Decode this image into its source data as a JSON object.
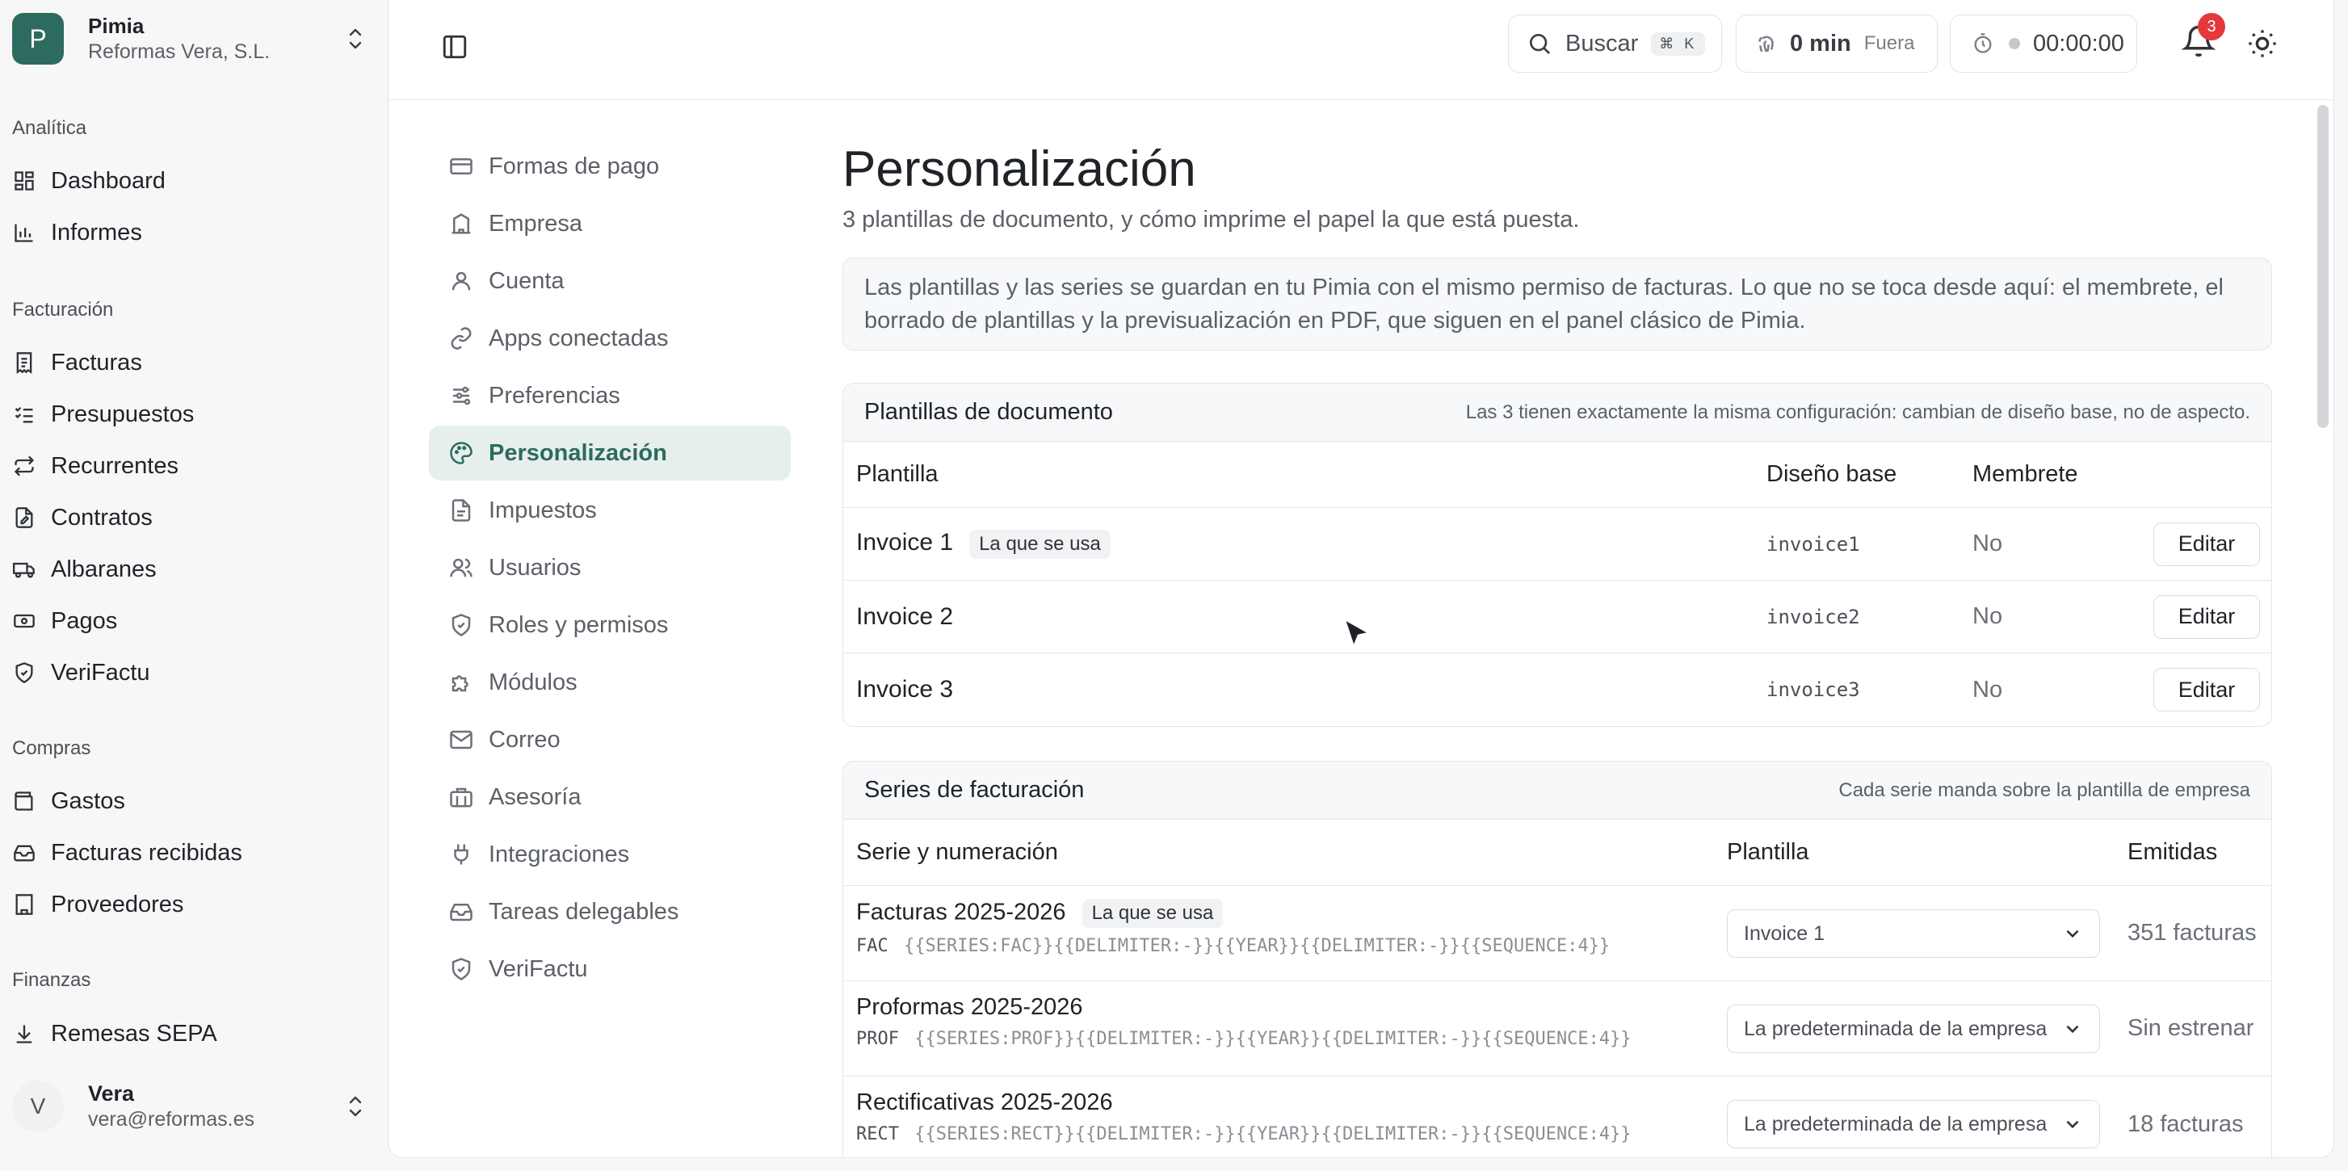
{
  "org": {
    "initial": "P",
    "name": "Pimia",
    "company": "Reformas Vera, S.L."
  },
  "nav": {
    "groups": [
      {
        "label": "Analítica",
        "items": [
          {
            "label": "Dashboard",
            "icon": "dashboard-icon"
          },
          {
            "label": "Informes",
            "icon": "bar-chart-icon"
          }
        ]
      },
      {
        "label": "Facturación",
        "items": [
          {
            "label": "Facturas",
            "icon": "invoice-icon"
          },
          {
            "label": "Presupuestos",
            "icon": "list-check-icon"
          },
          {
            "label": "Recurrentes",
            "icon": "repeat-icon"
          },
          {
            "label": "Contratos",
            "icon": "contract-icon"
          },
          {
            "label": "Albaranes",
            "icon": "truck-icon"
          },
          {
            "label": "Pagos",
            "icon": "banknote-icon"
          },
          {
            "label": "VeriFactu",
            "icon": "shield-check-icon"
          }
        ]
      },
      {
        "label": "Compras",
        "items": [
          {
            "label": "Gastos",
            "icon": "wallet-icon"
          },
          {
            "label": "Facturas recibidas",
            "icon": "inbox-icon"
          },
          {
            "label": "Proveedores",
            "icon": "building-icon"
          }
        ]
      },
      {
        "label": "Finanzas",
        "items": [
          {
            "label": "Remesas SEPA",
            "icon": "download-icon"
          }
        ]
      }
    ]
  },
  "user": {
    "initial": "V",
    "name": "Vera",
    "email": "vera@reformas.es"
  },
  "topbar": {
    "search_label": "Buscar",
    "search_shortcut": "⌘ K",
    "time_value": "0 min",
    "time_status": "Fuera",
    "timer_value": "00:00:00",
    "notifications_count": "3"
  },
  "settings_nav": [
    {
      "label": "Formas de pago",
      "icon": "credit-card-icon",
      "active": false
    },
    {
      "label": "Empresa",
      "icon": "building-icon",
      "active": false
    },
    {
      "label": "Cuenta",
      "icon": "user-icon",
      "active": false
    },
    {
      "label": "Apps conectadas",
      "icon": "link-icon",
      "active": false
    },
    {
      "label": "Preferencias",
      "icon": "sliders-icon",
      "active": false
    },
    {
      "label": "Personalización",
      "icon": "palette-icon",
      "active": true
    },
    {
      "label": "Impuestos",
      "icon": "document-icon",
      "active": false
    },
    {
      "label": "Usuarios",
      "icon": "users-icon",
      "active": false
    },
    {
      "label": "Roles y permisos",
      "icon": "shield-icon",
      "active": false
    },
    {
      "label": "Módulos",
      "icon": "puzzle-icon",
      "active": false
    },
    {
      "label": "Correo",
      "icon": "mail-icon",
      "active": false
    },
    {
      "label": "Asesoría",
      "icon": "briefcase-icon",
      "active": false
    },
    {
      "label": "Integraciones",
      "icon": "plug-icon",
      "active": false
    },
    {
      "label": "Tareas delegables",
      "icon": "inbox-icon",
      "active": false
    },
    {
      "label": "VeriFactu",
      "icon": "shield-check-icon",
      "active": false
    }
  ],
  "page": {
    "title": "Personalización",
    "subtitle": "3 plantillas de documento, y cómo imprime el papel la que está puesta.",
    "info": "Las plantillas y las series se guardan en tu Pimia con el mismo permiso de facturas. Lo que no se toca desde aquí: el membrete, el borrado de plantillas y la previsualización en PDF, que siguen en el panel clásico de Pimia."
  },
  "templates": {
    "title": "Plantillas de documento",
    "note": "Las 3 tienen exactamente la misma configuración: cambian de diseño base, no de aspecto.",
    "columns": {
      "name": "Plantilla",
      "base": "Diseño base",
      "letterhead": "Membrete"
    },
    "used_tag": "La que se usa",
    "edit_label": "Editar",
    "rows": [
      {
        "name": "Invoice 1",
        "used": true,
        "base": "invoice1",
        "letterhead": "No"
      },
      {
        "name": "Invoice 2",
        "used": false,
        "base": "invoice2",
        "letterhead": "No"
      },
      {
        "name": "Invoice 3",
        "used": false,
        "base": "invoice3",
        "letterhead": "No"
      }
    ]
  },
  "series": {
    "title": "Series de facturación",
    "note": "Cada serie manda sobre la plantilla de empresa",
    "columns": {
      "name": "Serie y numeración",
      "template": "Plantilla",
      "issued": "Emitidas"
    },
    "used_tag": "La que se usa",
    "rows": [
      {
        "name": "Facturas 2025-2026",
        "used": true,
        "prefix": "FAC",
        "pattern": "{{SERIES:FAC}}{{DELIMITER:-}}{{YEAR}}{{DELIMITER:-}}{{SEQUENCE:4}}",
        "template": "Invoice 1",
        "issued": "351 facturas"
      },
      {
        "name": "Proformas 2025-2026",
        "used": false,
        "prefix": "PROF",
        "pattern": "{{SERIES:PROF}}{{DELIMITER:-}}{{YEAR}}{{DELIMITER:-}}{{SEQUENCE:4}}",
        "template": "La predeterminada de la empresa",
        "issued": "Sin estrenar"
      },
      {
        "name": "Rectificativas 2025-2026",
        "used": false,
        "prefix": "RECT",
        "pattern": "{{SERIES:RECT}}{{DELIMITER:-}}{{YEAR}}{{DELIMITER:-}}{{SEQUENCE:4}}",
        "template": "La predeterminada de la empresa",
        "issued": "18 facturas"
      }
    ]
  },
  "colors": {
    "accent": "#2d6b5e",
    "active_bg": "#e6efec",
    "badge": "#e5383b"
  }
}
